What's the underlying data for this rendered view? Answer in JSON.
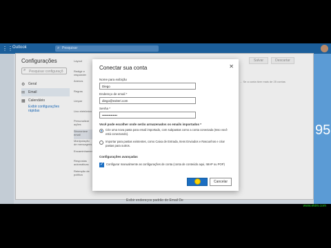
{
  "app": {
    "name": "Outlook",
    "search_placeholder": "Pesquisar"
  },
  "settings": {
    "title": "Configurações",
    "search_placeholder": "Pesquisar configuraçõ",
    "nav": [
      {
        "icon": "gear-icon",
        "label": "Geral"
      },
      {
        "icon": "mail-icon",
        "label": "Email"
      },
      {
        "icon": "calendar-icon",
        "label": "Calendário"
      }
    ],
    "nav_link": "Exibir configurações rápidas",
    "sub_nav": [
      "Layout",
      "Redigir e responder",
      "Anexos",
      "Regras",
      "Limpar",
      "Lixo eletrônico",
      "Personalizar ações",
      "Sincronizar email",
      "Manipulação de mensagens",
      "Encaminhamento",
      "Respostas automáticas",
      "Retenção de política"
    ],
    "save_label": "Salvar",
    "discard_label": "Descartar",
    "hint": "... Se a conta tiver mais de 25 contas",
    "bottom_note": "Exibir endereços padrão do Email De"
  },
  "dialog": {
    "title": "Conectar sua conta",
    "display_name_label": "Nome para exibição",
    "display_name_value": "Diego",
    "email_label": "Endereço de email *",
    "email_value": "diego@exiteri.com",
    "password_label": "Senha *",
    "password_value": "••••••••••••••",
    "question": "Você pode escolher onde serão armazenados os emails importados *",
    "option1": "Crie uma nova pasta para email importado, com subpastas como a conta conectada (Isso você está conectando).",
    "option2": "Importar para pastas existentes, como Caixa de Entrada, Itens Enviados e Rascunhos e criar pastas para outros.",
    "advanced_label": "Configurações avançadas",
    "manual_check": "Configurar manualmente as configurações de conta (conta de conteúdo aqui, IMAP ou POP)",
    "ok_label": "OK",
    "cancel_label": "Cancelar"
  },
  "background": {
    "number": "95"
  },
  "watermark": "www.ekim.com"
}
